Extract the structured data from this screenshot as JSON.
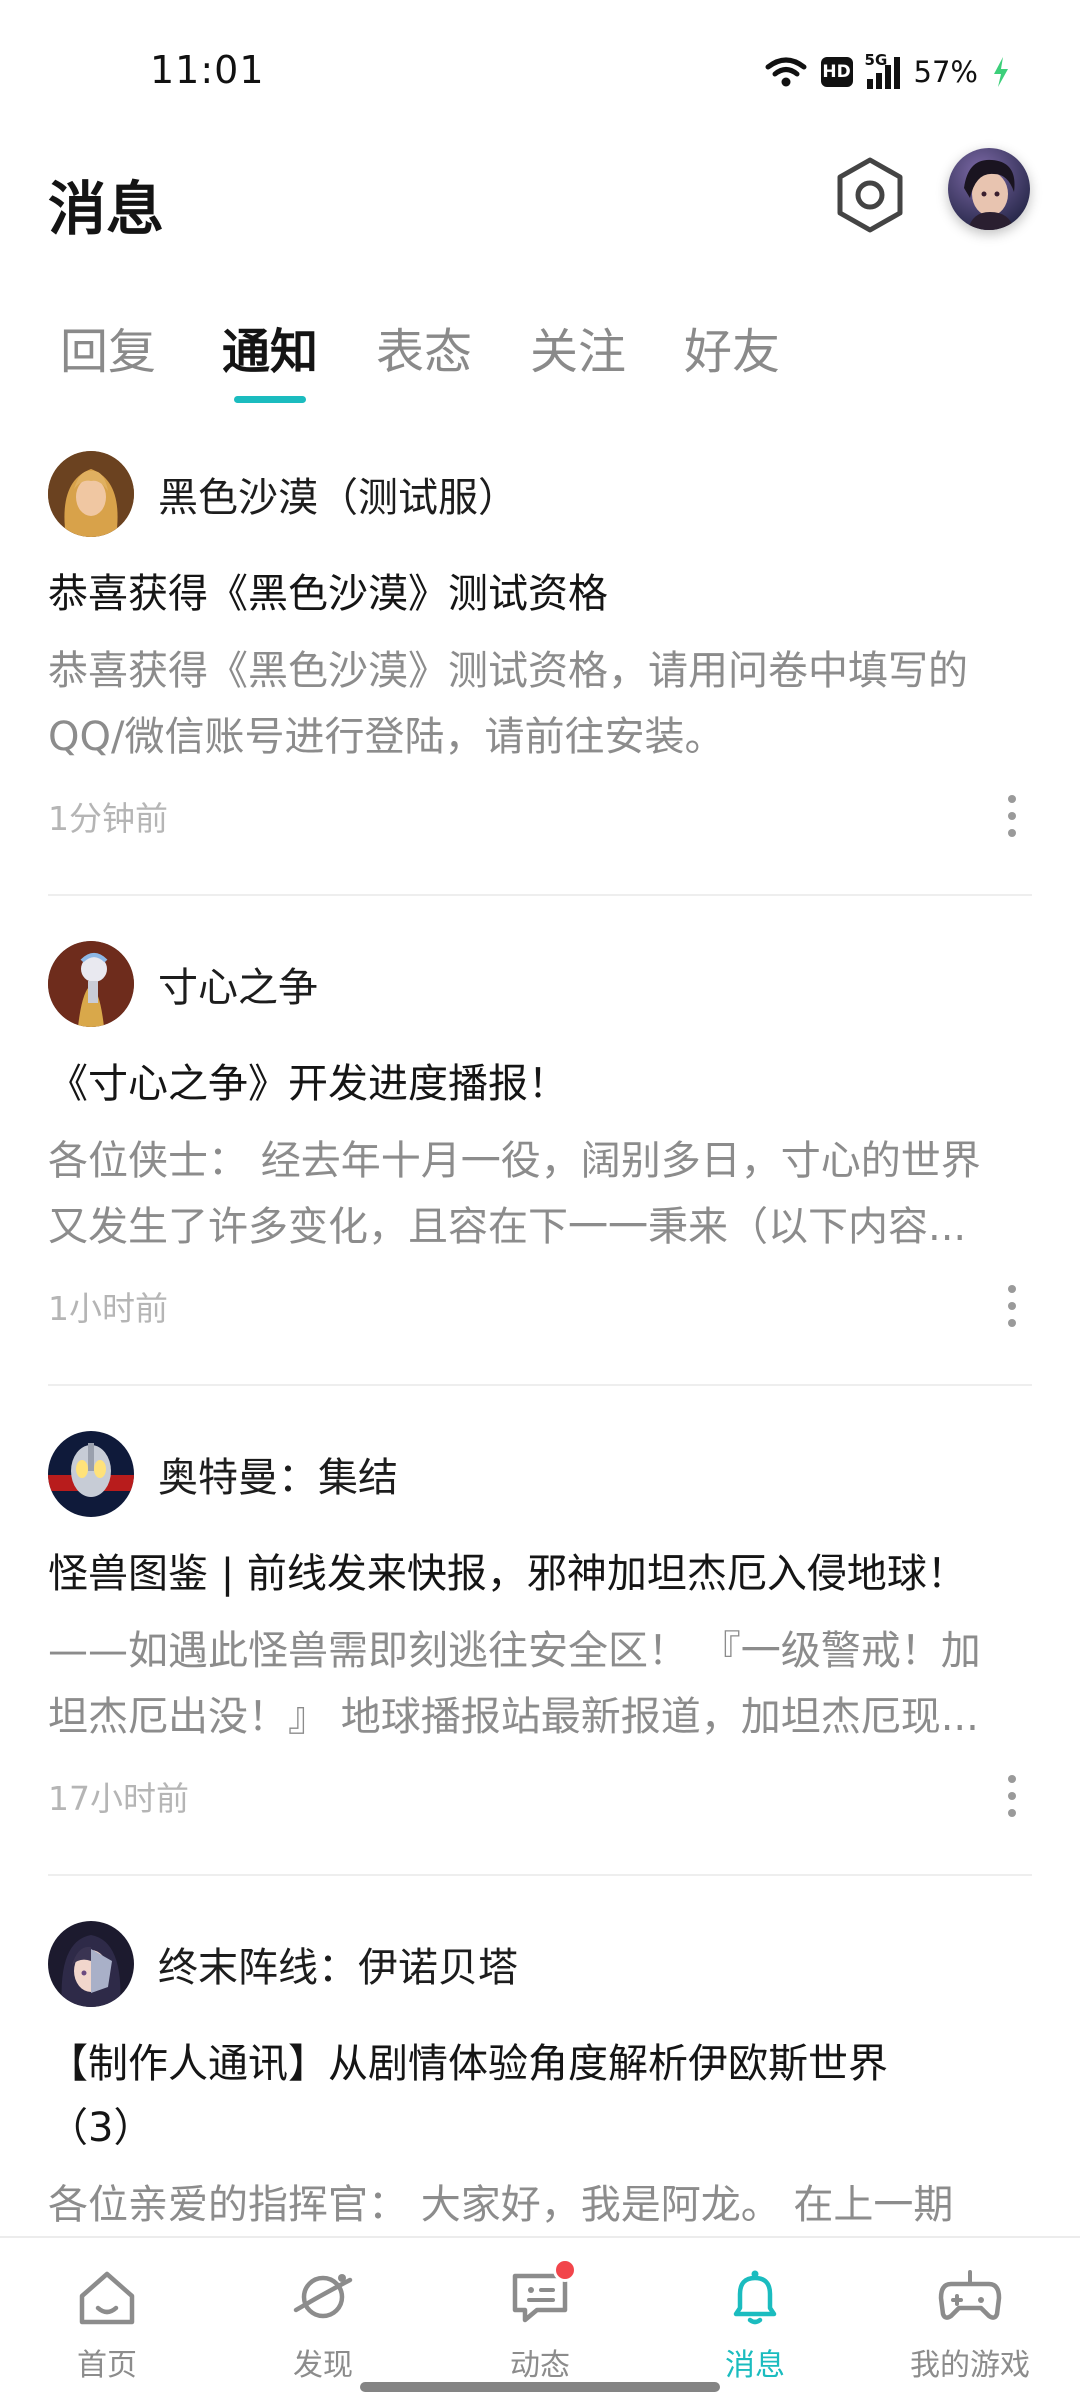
{
  "status_bar": {
    "time": "11:01",
    "network": "5G",
    "battery": "57%",
    "hd_label": "HD"
  },
  "header": {
    "title": "消息",
    "settings_icon": "hexagon-settings-icon",
    "avatar_icon": "user-avatar"
  },
  "tabs": [
    {
      "label": "回复",
      "active": false
    },
    {
      "label": "通知",
      "active": true
    },
    {
      "label": "表态",
      "active": false
    },
    {
      "label": "关注",
      "active": false
    },
    {
      "label": "好友",
      "active": false
    }
  ],
  "notifications": [
    {
      "sender": "黑色沙漠（测试服）",
      "title": "恭喜获得《黑色沙漠》测试资格",
      "body_lines": [
        "恭喜获得《黑色沙漠》测试资格，请用问卷中填写的",
        "QQ/微信账号进行登陆，请前往安装。"
      ],
      "time": "1分钟前"
    },
    {
      "sender": "寸心之争",
      "title": "《寸心之争》开发进度播报！",
      "body_lines": [
        "各位侠士： 经去年十月一役，阔别多日，寸心的世界",
        "又发生了许多变化，且容在下一一秉来（以下内容..."
      ],
      "time": "1小时前"
    },
    {
      "sender": "奥特曼：集结",
      "title": "怪兽图鉴 | 前线发来快报，邪神加坦杰厄入侵地球！",
      "body_lines": [
        "——如遇此怪兽需即刻逃往安全区！ 『一级警戒！加",
        "坦杰厄出没！』 地球播报站最新报道，加坦杰厄现..."
      ],
      "time": "17小时前"
    },
    {
      "sender": "终末阵线：伊诺贝塔",
      "title_lines": [
        "【制作人通讯】从剧情体验角度解析伊欧斯世界",
        "（3）"
      ],
      "body_lines": [
        "各位亲爱的指挥官： 大家好，我是阿龙。 在上一期"
      ]
    }
  ],
  "bottom_nav": [
    {
      "label": "首页",
      "icon": "home-icon",
      "active": false
    },
    {
      "label": "发现",
      "icon": "planet-icon",
      "active": false
    },
    {
      "label": "动态",
      "icon": "chat-icon",
      "active": false,
      "badge": true
    },
    {
      "label": "消息",
      "icon": "bell-icon",
      "active": true
    },
    {
      "label": "我的游戏",
      "icon": "gamepad-icon",
      "active": false
    }
  ],
  "colors": {
    "accent": "#1bbcbf",
    "badge_red": "#f2454b",
    "secondary_text": "#8c8c8c"
  }
}
